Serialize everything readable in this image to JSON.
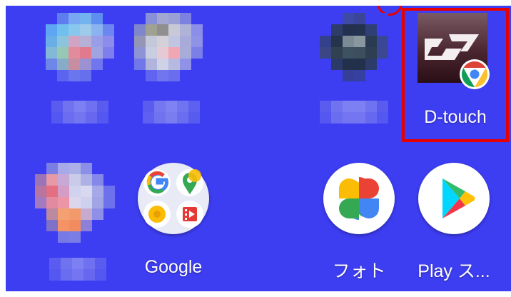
{
  "apps": {
    "dtouch": {
      "label": "D-touch",
      "icon": "d-touch-icon",
      "badge": "chrome-badge-icon"
    },
    "google": {
      "label": "Google",
      "icon": "google-folder-icon"
    },
    "photos": {
      "label": "フォト",
      "icon": "photos-pinwheel-icon"
    },
    "play": {
      "label": "Play ス...",
      "icon": "play-store-icon"
    }
  },
  "colors": {
    "background": "#3d3df2",
    "highlight": "#e60000"
  }
}
